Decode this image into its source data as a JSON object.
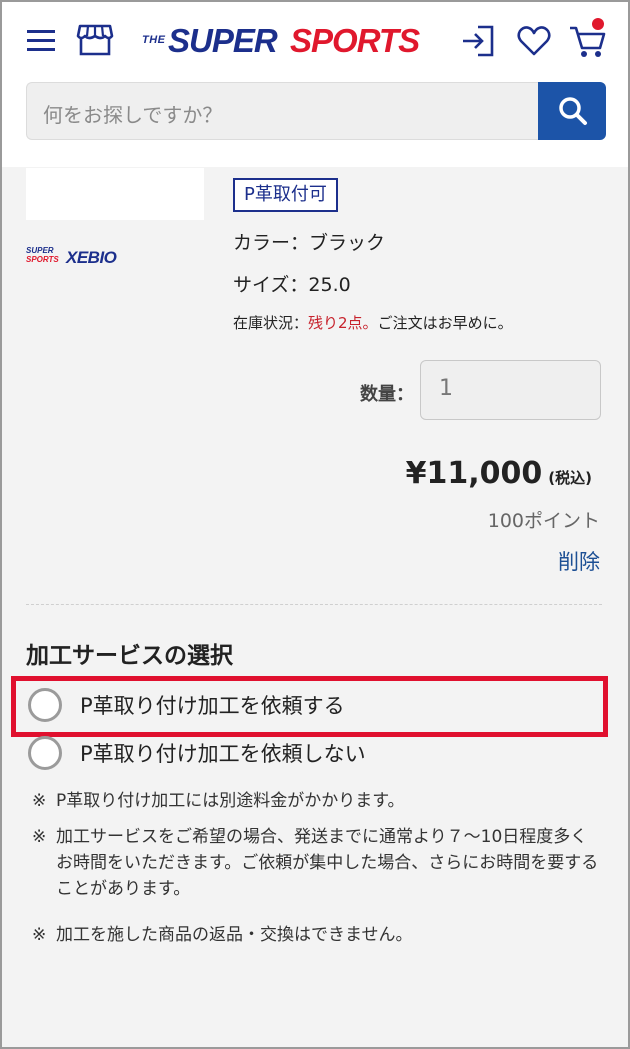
{
  "header": {
    "logo": {
      "the": "THE",
      "super": "SUPER",
      "sports": "SPORTS"
    },
    "icons": [
      "menu-icon",
      "store-icon",
      "login-icon",
      "heart-icon",
      "cart-icon"
    ],
    "accent_color": "#1c54a8",
    "brand_red": "#e0182d"
  },
  "search": {
    "placeholder": "何をお探しですか？"
  },
  "product": {
    "store_logo": {
      "small_top": "SUPER",
      "small_bottom": "SPORTS",
      "main": "XEBIO"
    },
    "badge": "P革取付可",
    "color_line": "カラー：ブラック",
    "size_line": "サイズ：25.0",
    "stock_prefix": "在庫状況：",
    "stock_warning": "残り2点。",
    "stock_suffix": "ご注文はお早めに。",
    "quantity_label": "数量：",
    "quantity_value": "1",
    "price": "¥11,000",
    "tax_note": "(税込)",
    "points": "100ポイント",
    "delete_label": "削除"
  },
  "service": {
    "title": "加工サービスの選択",
    "options": [
      {
        "label": "P革取り付け加工を依頼する",
        "selected": false
      },
      {
        "label": "P革取り付け加工を依頼しない",
        "selected": false
      }
    ],
    "notes": [
      {
        "mark": "※",
        "text": "P革取り付け加工には別途料金がかかります。"
      },
      {
        "mark": "※",
        "text": "加工サービスをご希望の場合、発送までに通常より７〜10日程度多くお時間をいただきます。ご依頼が集中した場合、さらにお時間を要することがあります。"
      },
      {
        "mark": "※",
        "text": "加工を施した商品の返品・交換はできません。"
      }
    ]
  }
}
